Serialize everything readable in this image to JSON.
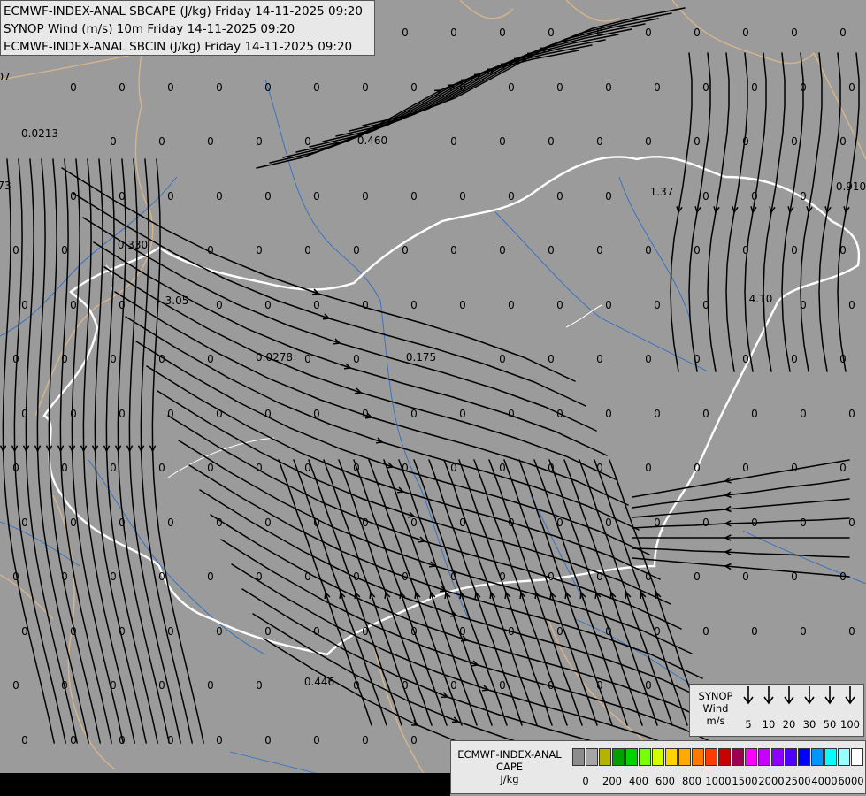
{
  "title_lines": [
    "ECMWF-INDEX-ANAL SBCAPE (J/kg) Friday 14-11-2025 09:20",
    "SYNOP Wind (m/s) 10m Friday 14-11-2025 09:20",
    "ECMWF-INDEX-ANAL SBCIN (J/kg) Friday 14-11-2025 09:20"
  ],
  "map_values": [
    "0",
    "07",
    "0.0213",
    "73",
    "0.330",
    "3.05",
    "0.0278",
    "0.460",
    "0.175",
    "1.37",
    "4.10",
    "0.910",
    "0.446"
  ],
  "wind_legend": {
    "title": [
      "SYNOP",
      "Wind",
      "m/s"
    ],
    "values": [
      "5",
      "10",
      "20",
      "30",
      "50",
      "100"
    ]
  },
  "cape_legend": {
    "title": [
      "ECMWF-INDEX-ANAL",
      "CAPE",
      "J/kg"
    ],
    "colors": [
      "#8c8c8c",
      "#a5a5a5",
      "#b4b400",
      "#00a000",
      "#00d200",
      "#78ff00",
      "#d2ff00",
      "#ffd200",
      "#ffaa00",
      "#ff7800",
      "#ff3c00",
      "#c80000",
      "#a00050",
      "#ff00ff",
      "#c800ff",
      "#8c00ff",
      "#5000ff",
      "#0000ff",
      "#0096ff",
      "#00ffff",
      "#96ffff",
      "#ffffff"
    ],
    "ticks": [
      "0",
      "200",
      "400",
      "600",
      "800",
      "1000",
      "1500",
      "2000",
      "2500",
      "4000",
      "6000"
    ]
  }
}
